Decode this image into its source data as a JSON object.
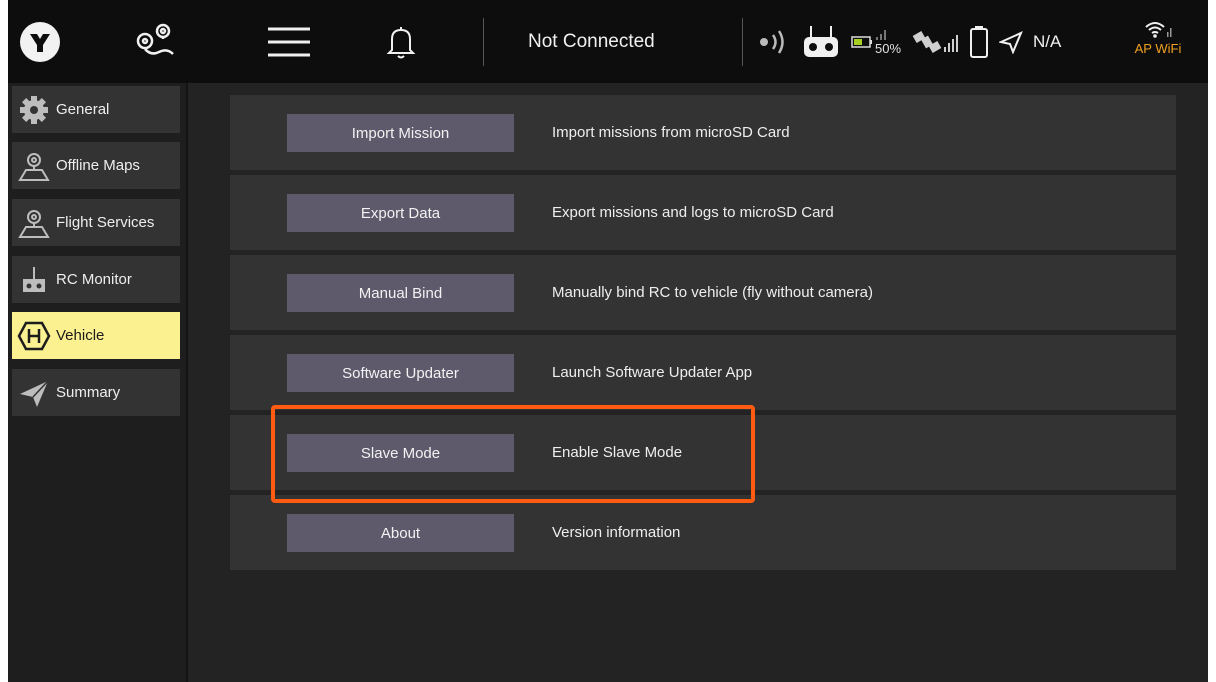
{
  "topbar": {
    "connection_status": "Not Connected",
    "battery_percent": "50%",
    "camera_status": "N/A",
    "wifi_label": "AP WiFi",
    "icons": [
      "yuneec-logo-icon",
      "mission-plan-icon",
      "menu-icon",
      "bell-icon",
      "signal-icon",
      "rc-controller-icon",
      "battery-icon",
      "satellite-icon",
      "vehicle-battery-icon",
      "vehicle-icon",
      "wifi-icon"
    ],
    "accent_color": "#f0a020"
  },
  "sidebar": {
    "items": [
      {
        "label": "General",
        "icon": "gear-icon",
        "active": false
      },
      {
        "label": "Offline Maps",
        "icon": "map-pin-icon",
        "active": false
      },
      {
        "label": "Flight Services",
        "icon": "map-pin-icon",
        "active": false
      },
      {
        "label": "RC Monitor",
        "icon": "rc-controller-icon",
        "active": false
      },
      {
        "label": "Vehicle",
        "icon": "hexagon-h-icon",
        "active": true
      },
      {
        "label": "Summary",
        "icon": "paper-plane-icon",
        "active": false
      }
    ],
    "active_color": "#fbf190"
  },
  "rows": [
    {
      "button": "Import Mission",
      "description": "Import missions from microSD Card"
    },
    {
      "button": "Export Data",
      "description": "Export missions and logs to microSD Card"
    },
    {
      "button": "Manual Bind",
      "description": "Manually bind RC to vehicle (fly without camera)"
    },
    {
      "button": "Software Updater",
      "description": "Launch Software Updater App"
    },
    {
      "button": "Slave Mode",
      "description": "Enable Slave Mode"
    },
    {
      "button": "About",
      "description": "Version information"
    }
  ],
  "highlight_color": "#ff5c12"
}
